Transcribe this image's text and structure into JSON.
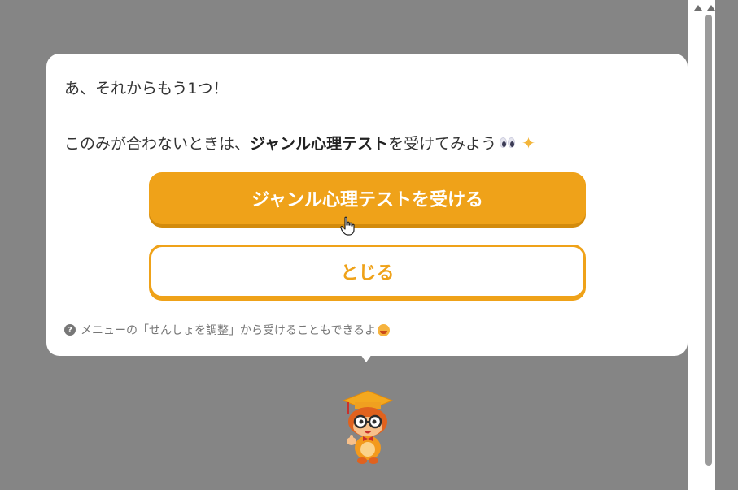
{
  "popup": {
    "line1": "あ、それからもう1つ！",
    "line2_prefix": "このみが合わないときは、",
    "line2_bold": "ジャンル心理テスト",
    "line2_suffix": "を受けてみよう",
    "primary_button_label": "ジャンル心理テストを受ける",
    "secondary_button_label": "とじる",
    "note_text": "メニューの「せんしょを調整」から受けることもできるよ"
  },
  "icons": {
    "eyes": "eyes-emoji",
    "sparkles": "sparkles-emoji",
    "help": "question-circle-icon",
    "smile": "smiling-face-emoji",
    "cursor": "hand-pointer-cursor",
    "mascot": "graduate-owl-mascot"
  },
  "colors": {
    "accent": "#efa219",
    "backdrop": "#858585",
    "card": "#ffffff"
  }
}
